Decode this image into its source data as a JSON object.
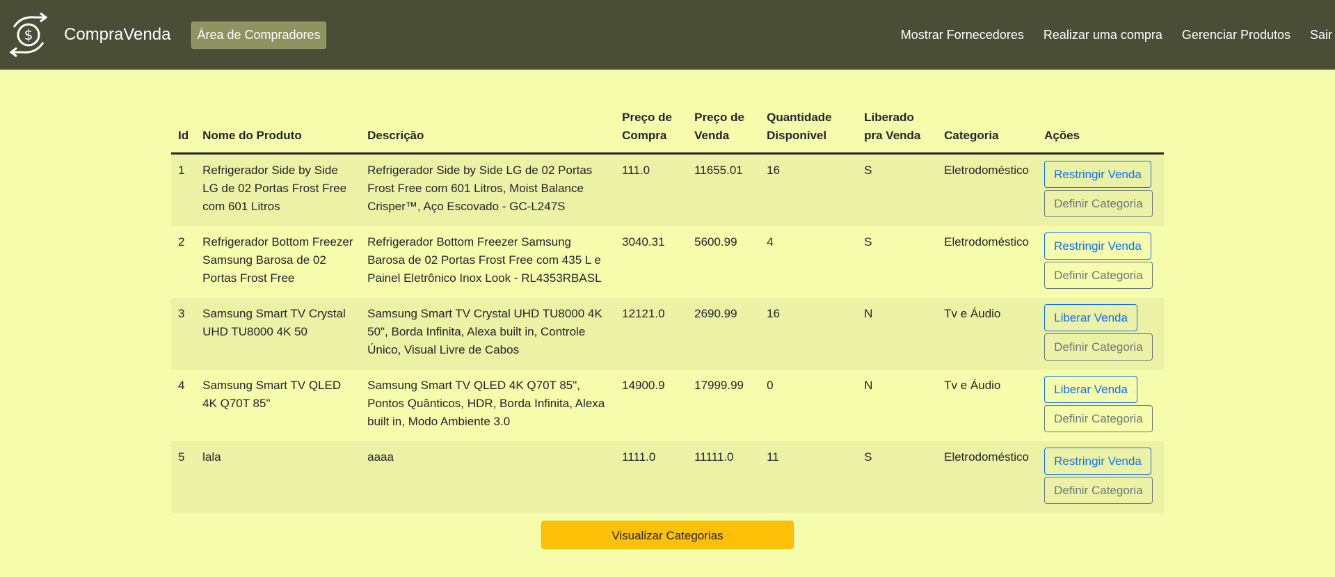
{
  "navbar": {
    "brand": "CompraVenda",
    "area_button": "Área de Compradores",
    "links": [
      "Mostrar Fornecedores",
      "Realizar uma compra",
      "Gerenciar Produtos",
      "Sair"
    ]
  },
  "table": {
    "headers": {
      "id": "Id",
      "nome": "Nome do Produto",
      "descricao": "Descrição",
      "preco_compra": "Preço de Compra",
      "preco_venda": "Preço de Venda",
      "quantidade": "Quantidade Disponível",
      "liberado": "Liberado pra Venda",
      "categoria": "Categoria",
      "acoes": "Ações"
    },
    "rows": [
      {
        "id": "1",
        "nome": "Refrigerador Side by Side LG de 02 Portas Frost Free com 601 Litros",
        "descricao": "Refrigerador Side by Side LG de 02 Portas Frost Free com 601 Litros, Moist Balance Crisper™, Aço Escovado - GC-L247S",
        "preco_compra": "111.0",
        "preco_venda": "11655.01",
        "quantidade": "16",
        "liberado": "S",
        "categoria": "Eletrodoméstico",
        "action1": "Restringir Venda",
        "action2": "Definir Categoria"
      },
      {
        "id": "2",
        "nome": "Refrigerador Bottom Freezer Samsung Barosa de 02 Portas Frost Free",
        "descricao": "Refrigerador Bottom Freezer Samsung Barosa de 02 Portas Frost Free com 435 L e Painel Eletrônico Inox Look - RL4353RBASL",
        "preco_compra": "3040.31",
        "preco_venda": "5600.99",
        "quantidade": "4",
        "liberado": "S",
        "categoria": "Eletrodoméstico",
        "action1": "Restringir Venda",
        "action2": "Definir Categoria"
      },
      {
        "id": "3",
        "nome": "Samsung Smart TV Crystal UHD TU8000 4K 50",
        "descricao": "Samsung Smart TV Crystal UHD TU8000 4K 50\", Borda Infinita, Alexa built in, Controle Único, Visual Livre de Cabos",
        "preco_compra": "12121.0",
        "preco_venda": "2690.99",
        "quantidade": "16",
        "liberado": "N",
        "categoria": "Tv e Áudio",
        "action1": "Liberar Venda",
        "action2": "Definir Categoria"
      },
      {
        "id": "4",
        "nome": "Samsung Smart TV QLED 4K Q70T 85\"",
        "descricao": "Samsung Smart TV QLED 4K Q70T 85\", Pontos Quânticos, HDR, Borda Infinita, Alexa built in, Modo Ambiente 3.0",
        "preco_compra": "14900.9",
        "preco_venda": "17999.99",
        "quantidade": "0",
        "liberado": "N",
        "categoria": "Tv e Áudio",
        "action1": "Liberar Venda",
        "action2": "Definir Categoria"
      },
      {
        "id": "5",
        "nome": "lala",
        "descricao": "aaaa",
        "preco_compra": "1111.0",
        "preco_venda": "11111.0",
        "quantidade": "11",
        "liberado": "S",
        "categoria": "Eletrodoméstico",
        "action1": "Restringir Venda",
        "action2": "Definir Categoria"
      }
    ]
  },
  "footer_button": "Visualizar Categorias",
  "colors": {
    "navbar": "#4b4e36",
    "page_bg": "#f5fcac",
    "row_stripe": "#ecf2a5",
    "accent": "#ffc107",
    "primary": "#0d6efd",
    "secondary": "#6c757d"
  }
}
